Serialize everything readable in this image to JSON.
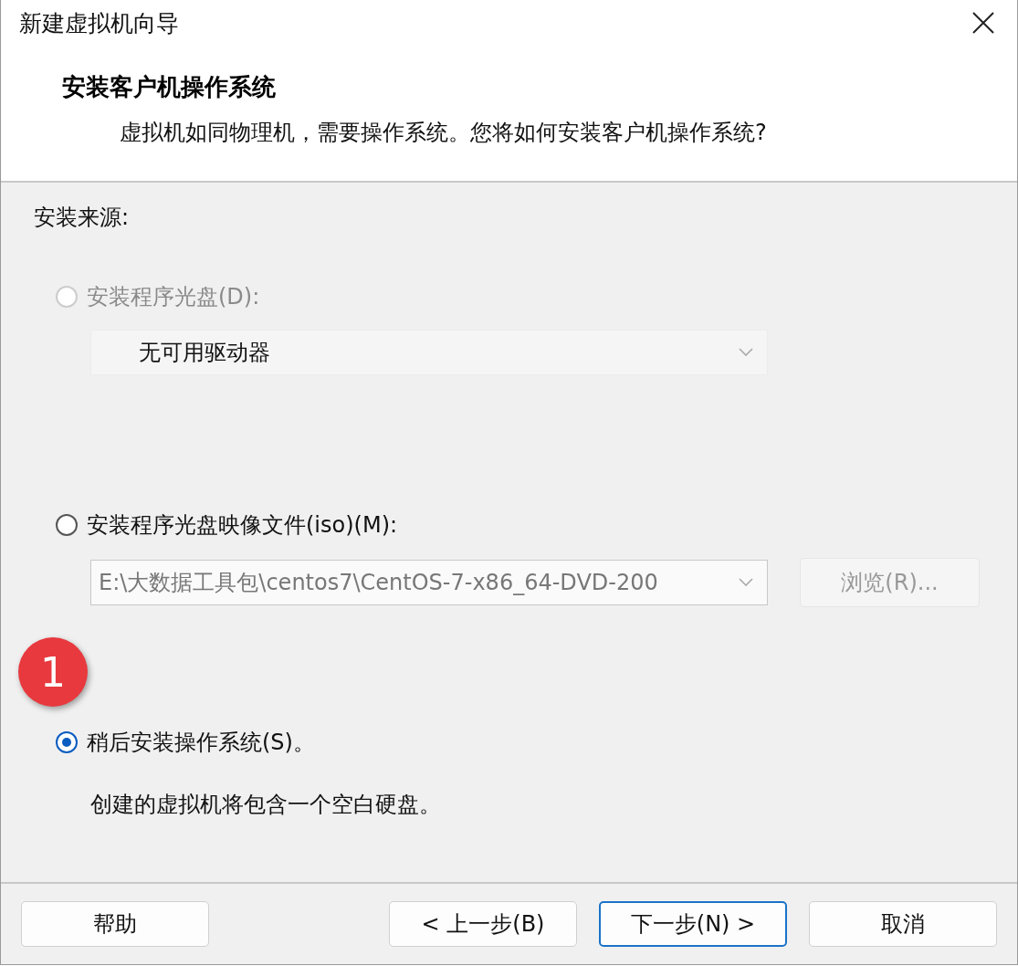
{
  "window": {
    "title": "新建虚拟机向导"
  },
  "header": {
    "heading": "安装客户机操作系统",
    "subtitle": "虚拟机如同物理机，需要操作系统。您将如何安装客户机操作系统?"
  },
  "source_label": "安装来源:",
  "options": [
    {
      "kind": "dropdown",
      "label": "安装程序光盘(D):",
      "selected": false,
      "disabled": true,
      "value": "无可用驱动器"
    },
    {
      "kind": "file",
      "label": "安装程序光盘映像文件(iso)(M):",
      "selected": false,
      "disabled": false,
      "value": "E:\\大数据工具包\\centos7\\CentOS-7-x86_64-DVD-200",
      "browse": {
        "label": "浏览(R)...",
        "disabled": true
      }
    },
    {
      "kind": "note",
      "label": "稍后安装操作系统(S)。",
      "selected": true,
      "disabled": false,
      "note": "创建的虚拟机将包含一个空白硬盘。",
      "badge": "1"
    }
  ],
  "buttons": [
    {
      "label": "帮助",
      "default": false
    },
    {
      "label": "< 上一步(B)",
      "default": false
    },
    {
      "label": "下一步(N) >",
      "default": true
    },
    {
      "label": "取消",
      "default": false
    }
  ]
}
